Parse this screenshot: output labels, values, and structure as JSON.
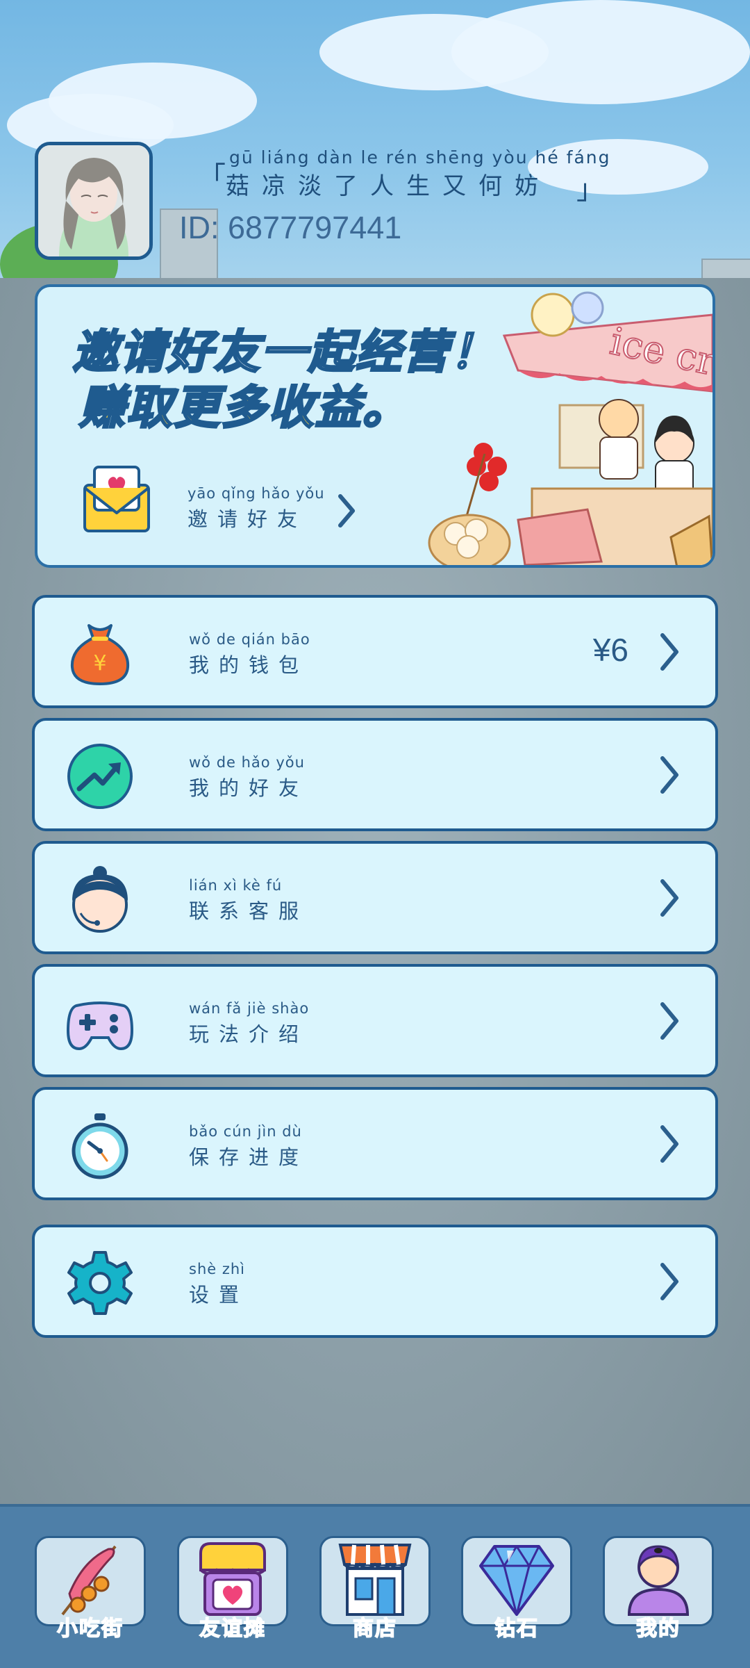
{
  "header": {
    "slogan_pinyin": "gū liáng dàn  le  rén shēng yòu  hé fáng",
    "slogan_text": "菇凉淡了人生又何妨",
    "bracket_open": "「",
    "bracket_close": "」",
    "user_id": "ID: 6877797441"
  },
  "invite": {
    "title": "邀请好友一起经营！",
    "subtitle": "赚取更多收益。",
    "button_pinyin": "yāo qǐng hǎo yǒu",
    "button_text": "邀请好友",
    "illustration_sign": "ice cream"
  },
  "menu": {
    "wallet": {
      "pinyin": "wǒ  de  qián bāo",
      "text": "我的钱包",
      "value": "¥6",
      "icon": "money-bag-icon"
    },
    "friends": {
      "pinyin": "wǒ  de  hǎo yǒu",
      "text": "我的好友",
      "icon": "trend-up-icon"
    },
    "support": {
      "pinyin": "lián  xì  kè  fú",
      "text": "联系客服",
      "icon": "customer-service-icon"
    },
    "guide": {
      "pinyin": "wán  fǎ  jiè shào",
      "text": "玩法介绍",
      "icon": "gamepad-icon"
    },
    "save": {
      "pinyin": "bǎo cún  jìn  dù",
      "text": "保存进度",
      "icon": "stopwatch-icon"
    },
    "settings": {
      "pinyin": "shè  zhì",
      "text": "设置",
      "icon": "gear-icon"
    }
  },
  "nav": {
    "items": [
      {
        "label": "小吃街",
        "icon": "sausage-skewer-icon"
      },
      {
        "label": "友谊摊",
        "icon": "stall-heart-icon"
      },
      {
        "label": "商店",
        "icon": "shop-icon"
      },
      {
        "label": "钻石",
        "icon": "diamond-icon"
      },
      {
        "label": "我的",
        "icon": "profile-icon"
      }
    ]
  },
  "colors": {
    "card_bg": "#daf5fd",
    "card_border": "#1f5b8f",
    "text_primary": "#2a5a86",
    "title_yellow": "#ffd23b",
    "nav_bg": "#4e7fa8",
    "nav_label": "#7a3fc2"
  }
}
